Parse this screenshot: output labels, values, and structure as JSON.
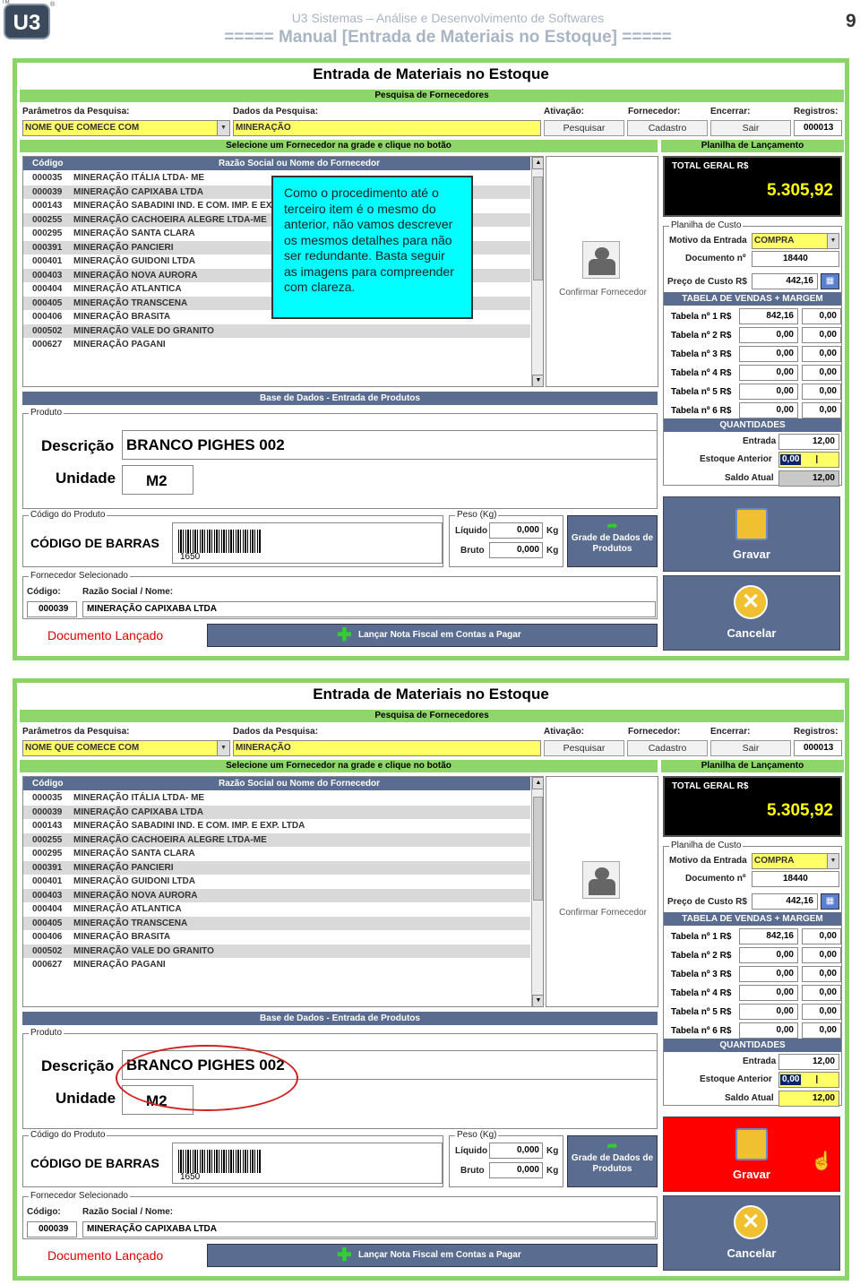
{
  "header": {
    "line1": "U3 Sistemas – Análise e Desenvolvimento de Softwares",
    "line2": "===== Manual [Entrada de Materiais no Estoque] =====",
    "page": "9",
    "logo": "U3",
    "tm": "TM",
    "reg": "®"
  },
  "form": {
    "title": "Entrada de Materiais no Estoque",
    "search_bar": "Pesquisa de Fornecedores",
    "lbl_param": "Parâmetros da Pesquisa:",
    "lbl_dados": "Dados da Pesquisa:",
    "lbl_ativ": "Ativação:",
    "lbl_forn": "Fornecedor:",
    "lbl_enc": "Encerrar:",
    "lbl_reg": "Registros:",
    "param_value": "NOME QUE COMECE COM",
    "dados_value": "MINERAÇÃO",
    "btn_pesquisar": "Pesquisar",
    "btn_cadastro": "Cadastro",
    "btn_sair": "Sair",
    "registros": "000013",
    "select_bar": "Selecione um Fornecedor na grade e clique no botão",
    "planilha_bar": "Planilha de Lançamento",
    "col_codigo": "Código",
    "col_razao": "Razão Social ou Nome do Fornecedor",
    "rows": [
      {
        "c": "000035",
        "n": "MINERAÇÃO ITÁLIA LTDA- ME"
      },
      {
        "c": "000039",
        "n": "MINERAÇÃO CAPIXABA LTDA"
      },
      {
        "c": "000143",
        "n": "MINERAÇÃO SABADINI IND. E COM. IMP. E EXP. LTDA"
      },
      {
        "c": "000255",
        "n": "MINERAÇÃO CACHOEIRA ALEGRE LTDA-ME"
      },
      {
        "c": "000295",
        "n": "MINERAÇÃO SANTA CLARA"
      },
      {
        "c": "000391",
        "n": "MINERAÇÃO PANCIERI"
      },
      {
        "c": "000401",
        "n": "MINERAÇÃO GUIDONI LTDA"
      },
      {
        "c": "000403",
        "n": "MINERAÇÃO NOVA AURORA"
      },
      {
        "c": "000404",
        "n": "MINERAÇÃO ATLANTICA"
      },
      {
        "c": "000405",
        "n": "MINERAÇÃO TRANSCENA"
      },
      {
        "c": "000406",
        "n": "MINERAÇÃO BRASITA"
      },
      {
        "c": "000502",
        "n": "MINERAÇÃO VALE DO GRANITO"
      },
      {
        "c": "000627",
        "n": "MINERAÇÃO PAGANI"
      }
    ],
    "confirmar": "Confirmar Fornecedor",
    "total_label": "TOTAL GERAL R$",
    "total_value": "5.305,92",
    "planilha_custo": "Planilha de Custo",
    "motivo_label": "Motivo da Entrada",
    "motivo_value": "COMPRA",
    "documento_label": "Documento nº",
    "documento_value": "18440",
    "preco_label": "Preço de Custo R$",
    "preco_value": "442,16",
    "tabela_bar": "TABELA DE VENDAS + MARGEM",
    "tabelas": [
      {
        "l": "Tabela nº 1 R$",
        "v": "842,16",
        "p": "0,00"
      },
      {
        "l": "Tabela nº 2 R$",
        "v": "0,00",
        "p": "0,00"
      },
      {
        "l": "Tabela nº 3 R$",
        "v": "0,00",
        "p": "0,00"
      },
      {
        "l": "Tabela nº 4 R$",
        "v": "0,00",
        "p": "0,00"
      },
      {
        "l": "Tabela nº 5 R$",
        "v": "0,00",
        "p": "0,00"
      },
      {
        "l": "Tabela nº 6 R$",
        "v": "0,00",
        "p": "0,00"
      }
    ],
    "quant_bar": "QUANTIDADES",
    "entrada_label": "Entrada",
    "entrada_value": "12,00",
    "estoque_label": "Estoque Anterior",
    "estoque_value": "0,00",
    "saldo_label": "Saldo Atual",
    "saldo_value": "12,00",
    "base_bar": "Base de Dados - Entrada de Produtos",
    "produto": "Produto",
    "descricao_label": "Descrição",
    "descricao_value": "BRANCO PIGHES 002",
    "unidade_label": "Unidade",
    "unidade_value": "M2",
    "codigo_produto": "Código do Produto",
    "codigo_barras": "CÓDIGO DE BARRAS",
    "barcode_num": "1650",
    "peso": "Peso (Kg)",
    "liquido_label": "Líquido",
    "liquido_value": "0,000",
    "bruto_label": "Bruto",
    "bruto_value": "0,000",
    "kg": "Kg",
    "grade_btn": "Grade de Dados de Produtos",
    "gravar": "Gravar",
    "cancelar": "Cancelar",
    "forn_sel": "Fornecedor Selecionado",
    "codigo_lbl": "Código:",
    "razao_lbl": "Razão Social / Nome:",
    "forn_code": "000039",
    "forn_name": "MINERAÇÃO CAPIXABA LTDA",
    "doc_lancado": "Documento Lançado",
    "lancar": "Lançar Nota Fiscal em Contas a Pagar"
  },
  "note": "Como o procedimento até o terceiro item é o mesmo do anterior, não vamos descrever os mesmos detalhes para não ser redundante. Basta seguir as imagens para compreender com clareza.",
  "colors": {
    "green": "#8fd66a",
    "dark_bar": "#5a6c8f",
    "yellow": "#ffff66",
    "red_gravar": "#ff0000",
    "note": "#00ffff"
  }
}
